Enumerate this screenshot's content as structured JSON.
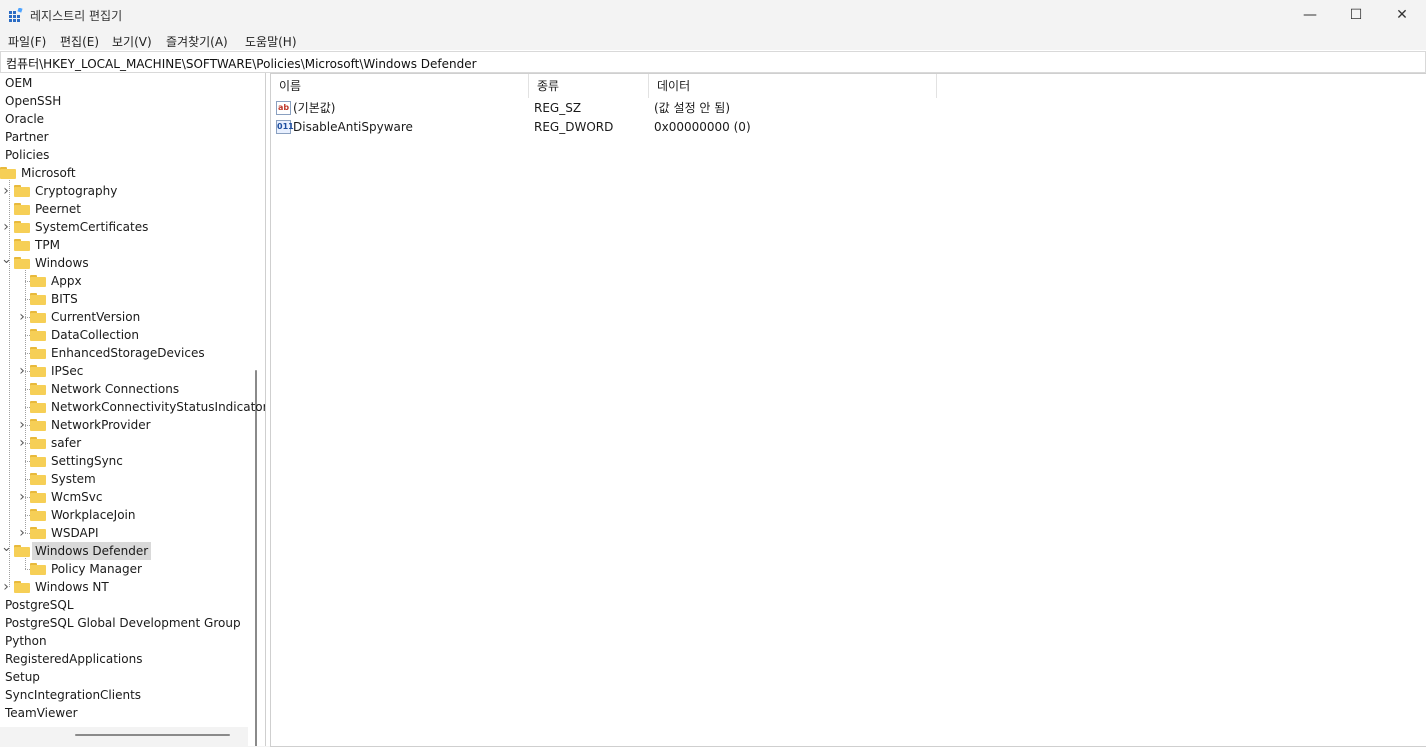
{
  "window": {
    "title": "레지스트리 편집기",
    "controls": {
      "minimize": "—",
      "maximize": "☐",
      "close": "✕"
    }
  },
  "menu": [
    "파일(F)",
    "편집(E)",
    "보기(V)",
    "즐겨찾기(A)",
    "도움말(H)"
  ],
  "address": "컴퓨터\\HKEY_LOCAL_MACHINE\\SOFTWARE\\Policies\\Microsoft\\Windows Defender",
  "tree": [
    {
      "label": "OEM",
      "level": 0,
      "expander": "none"
    },
    {
      "label": "OpenSSH",
      "level": 0,
      "expander": "none"
    },
    {
      "label": "Oracle",
      "level": 0,
      "expander": "none"
    },
    {
      "label": "Partner",
      "level": 0,
      "expander": "none"
    },
    {
      "label": "Policies",
      "level": 0,
      "expander": "none"
    },
    {
      "label": "Microsoft",
      "level": 1,
      "expander": "none"
    },
    {
      "label": "Cryptography",
      "level": 2,
      "expander": "collapsed"
    },
    {
      "label": "Peernet",
      "level": 2,
      "expander": "none"
    },
    {
      "label": "SystemCertificates",
      "level": 2,
      "expander": "collapsed"
    },
    {
      "label": "TPM",
      "level": 2,
      "expander": "none"
    },
    {
      "label": "Windows",
      "level": 2,
      "expander": "expanded"
    },
    {
      "label": "Appx",
      "level": 3,
      "expander": "none"
    },
    {
      "label": "BITS",
      "level": 3,
      "expander": "none"
    },
    {
      "label": "CurrentVersion",
      "level": 3,
      "expander": "collapsed"
    },
    {
      "label": "DataCollection",
      "level": 3,
      "expander": "none"
    },
    {
      "label": "EnhancedStorageDevices",
      "level": 3,
      "expander": "none"
    },
    {
      "label": "IPSec",
      "level": 3,
      "expander": "collapsed"
    },
    {
      "label": "Network Connections",
      "level": 3,
      "expander": "none"
    },
    {
      "label": "NetworkConnectivityStatusIndicator",
      "level": 3,
      "expander": "none"
    },
    {
      "label": "NetworkProvider",
      "level": 3,
      "expander": "collapsed"
    },
    {
      "label": "safer",
      "level": 3,
      "expander": "collapsed"
    },
    {
      "label": "SettingSync",
      "level": 3,
      "expander": "none"
    },
    {
      "label": "System",
      "level": 3,
      "expander": "none"
    },
    {
      "label": "WcmSvc",
      "level": 3,
      "expander": "collapsed"
    },
    {
      "label": "WorkplaceJoin",
      "level": 3,
      "expander": "none"
    },
    {
      "label": "WSDAPI",
      "level": 3,
      "expander": "collapsed"
    },
    {
      "label": "Windows Defender",
      "level": 2,
      "expander": "expanded",
      "selected": true
    },
    {
      "label": "Policy Manager",
      "level": 3,
      "expander": "none"
    },
    {
      "label": "Windows NT",
      "level": 2,
      "expander": "collapsed"
    },
    {
      "label": "PostgreSQL",
      "level": 0,
      "expander": "none"
    },
    {
      "label": "PostgreSQL Global Development Group",
      "level": 0,
      "expander": "none"
    },
    {
      "label": "Python",
      "level": 0,
      "expander": "none"
    },
    {
      "label": "RegisteredApplications",
      "level": 0,
      "expander": "none"
    },
    {
      "label": "Setup",
      "level": 0,
      "expander": "none"
    },
    {
      "label": "SyncIntegrationClients",
      "level": 0,
      "expander": "none"
    },
    {
      "label": "TeamViewer",
      "level": 0,
      "expander": "none"
    }
  ],
  "list": {
    "columns": {
      "name": "이름",
      "type": "종류",
      "data": "데이터"
    },
    "rows": [
      {
        "icon": "string-value-icon",
        "icon_text": "ab",
        "name": "(기본값)",
        "type": "REG_SZ",
        "data": "(값 설정 안 됨)"
      },
      {
        "icon": "binary-value-icon",
        "icon_text": "011",
        "name": "DisableAntiSpyware",
        "type": "REG_DWORD",
        "data": "0x00000000 (0)"
      }
    ]
  }
}
